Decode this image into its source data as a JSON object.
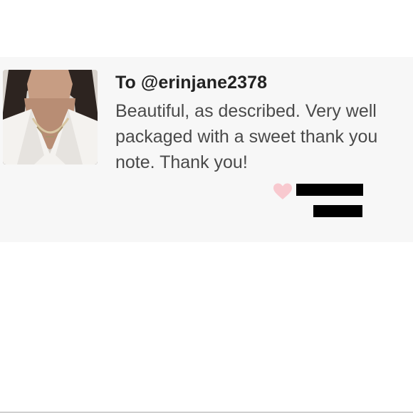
{
  "review": {
    "avatar_icon": "reviewer-photo",
    "recipient_label": "To @erinjane2378",
    "text": "Beautiful, as described. Very well packaged with a sweet thank you note. Thank you!",
    "heart_icon": "heart-icon",
    "colors": {
      "card_background": "#f7f7f7",
      "recipient_text": "#222222",
      "body_text": "#4a4a4a",
      "heart": "#f8c9cf"
    }
  }
}
